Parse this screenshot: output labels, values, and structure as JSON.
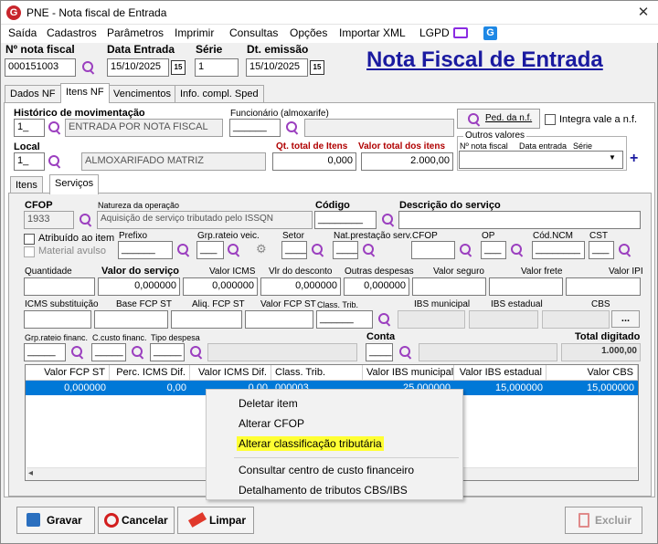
{
  "window": {
    "title": "PNE - Nota fiscal de Entrada",
    "logo_letter": "G",
    "close": "✕"
  },
  "menu": [
    "Saída",
    "Cadastros",
    "Parâmetros",
    "Imprimir",
    "Consultas",
    "Opções",
    "Importar XML",
    "LGPD"
  ],
  "header": {
    "nf_label": "Nº nota fiscal",
    "nf_value": "000151003",
    "data_entrada_label": "Data Entrada",
    "data_entrada_value": "15/10/2025",
    "serie_label": "Série",
    "serie_value": "1",
    "dt_emissao_label": "Dt. emissão",
    "dt_emissao_value": "15/10/2025",
    "cal_icon_text": "15",
    "page_title": "Nota Fiscal de Entrada"
  },
  "tabs": [
    "Dados NF",
    "Itens NF",
    "Vencimentos",
    "Info. compl. Sped"
  ],
  "itens": {
    "historico_label": "Histórico de movimentação",
    "historico_code": "1_",
    "historico_desc": "ENTRADA POR NOTA FISCAL",
    "funcionario_label": "Funcionário (almoxarife)",
    "funcionario_value": "______",
    "ped_button": "Ped. da n.f.",
    "integra_label": "Integra vale a n.f.",
    "local_label": "Local",
    "local_code": "1_",
    "local_desc": "ALMOXARIFADO MATRIZ",
    "qt_total_label": "Qt. total de Itens",
    "qt_total_value": "0,000",
    "valor_total_label": "Valor total dos itens",
    "valor_total_value": "2.000,00",
    "outros_label": "Outros valores",
    "outros_nf": "Nº nota fiscal",
    "outros_data": "Data entrada",
    "outros_serie": "Série",
    "plus": "+"
  },
  "subtabs": [
    "Itens",
    "Serviços"
  ],
  "servicos": {
    "cfop_label": "CFOP",
    "cfop_value": "1933",
    "natureza_label": "Natureza da operação",
    "natureza_value": "Aquisição de serviço tributado pelo ISSQN",
    "codigo_label": "Código",
    "codigo_value": "________",
    "descricao_label": "Descrição do serviço",
    "atribuido_label": "Atribuído ao item",
    "material_label": "Material avulso",
    "prefixo_label": "Prefixo",
    "prefixo_value": "______",
    "grp_rateio_label": "Grp.rateio veic.",
    "grp_rateio_value": "___",
    "setor_label": "Setor",
    "setor_value": "____",
    "nat_prest_label": "Nat.prestação serv.",
    "nat_prest_value": "____",
    "cfop2_label": "CFOP",
    "op_label": "OP",
    "op_value": "___",
    "ncm_label": "Cód.NCM",
    "ncm_value": "________",
    "cst_label": "CST",
    "cst_value": "___",
    "quantidade_label": "Quantidade",
    "valor_servico_label": "Valor do serviço",
    "valor_servico_value": "0,000000",
    "valor_icms_label": "Valor ICMS",
    "valor_icms_value": "0,000000",
    "vlr_desconto_label": "Vlr do desconto",
    "vlr_desconto_value": "0,000000",
    "outras_label": "Outras despesas",
    "outras_value": "0,000000",
    "seguro_label": "Valor seguro",
    "frete_label": "Valor frete",
    "ipi_label": "Valor IPI",
    "icms_subst_label": "ICMS substituição",
    "base_fcp_label": "Base FCP ST",
    "aliq_fcp_label": "Aliq. FCP ST",
    "valor_fcp_label": "Valor FCP ST",
    "class_trib_label": "Class. Trib.",
    "class_trib_value": "______",
    "ibs_mun_label": "IBS municipal",
    "ibs_est_label": "IBS estadual",
    "cbs_label": "CBS",
    "cbs_button": "...",
    "grp_financ_label": "Grp.rateio financ.",
    "grp_financ_value": "_____",
    "ccusto_label": "C.custo financ.",
    "ccusto_value": "_____",
    "tipo_desp_label": "Tipo despesa",
    "tipo_desp_value": "_____",
    "conta_label": "Conta",
    "conta_value": "____",
    "total_label": "Total digitado",
    "total_value": "1.000,00"
  },
  "grid": {
    "headers": [
      "Valor FCP ST",
      "Perc. ICMS Dif.",
      "Valor ICMS Dif.",
      "Class. Trib.",
      "Valor IBS municipal",
      "Valor IBS estadual",
      "Valor CBS"
    ],
    "row": [
      "0,000000",
      "0,00",
      "0,00",
      "000003",
      "25,000000",
      "15,000000",
      "15,000000"
    ],
    "scroll_left": "◂"
  },
  "context_menu": [
    "Deletar item",
    "Alterar CFOP",
    "Alterar classificação tributária",
    "Consultar centro de custo financeiro",
    "Detalhamento de tributos CBS/IBS"
  ],
  "buttons": {
    "gravar": "Gravar",
    "cancelar": "Cancelar",
    "limpar": "Limpar",
    "excluir": "Excluir"
  },
  "colors": {
    "accent": "#0078d7",
    "title": "#1a1aa0",
    "red_label": "#b00000",
    "highlight": "#ffff33"
  }
}
